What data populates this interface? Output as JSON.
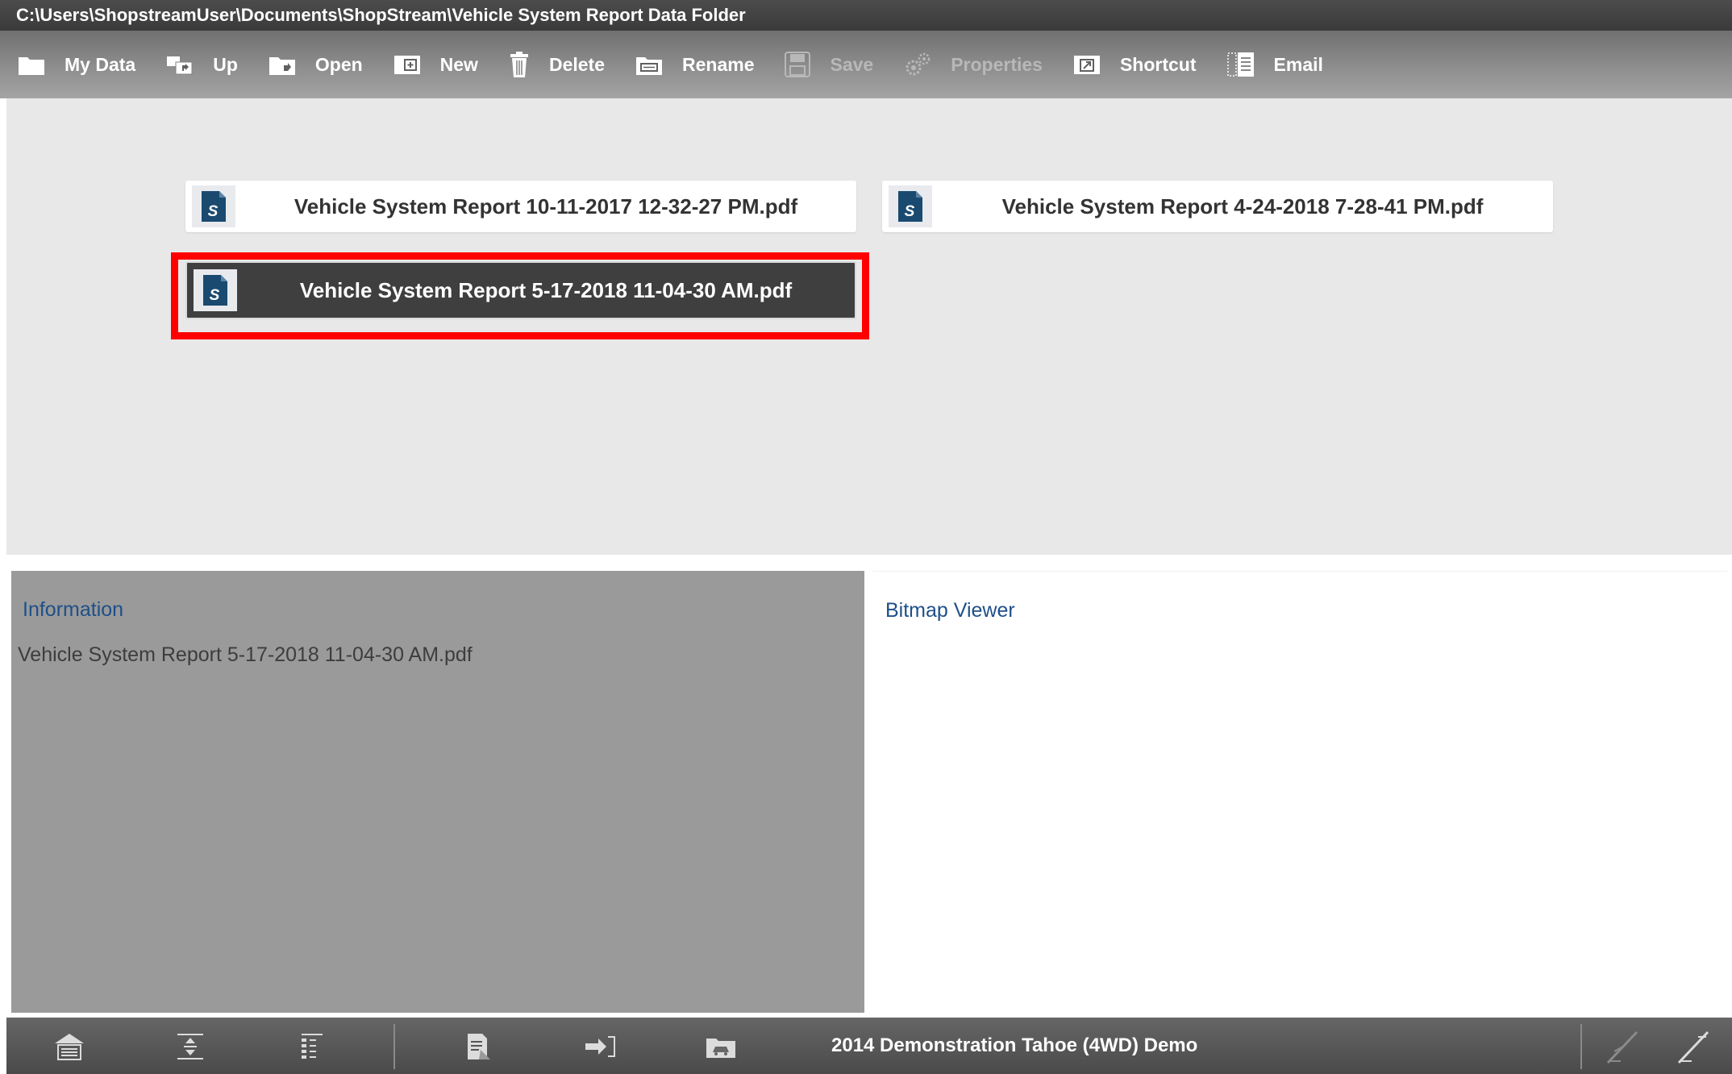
{
  "window": {
    "path": "C:\\Users\\ShopstreamUser\\Documents\\ShopStream\\Vehicle System Report Data Folder"
  },
  "toolbar": {
    "buttons": [
      {
        "label": "My Data",
        "icon": "folder-icon",
        "enabled": true
      },
      {
        "label": "Up",
        "icon": "up-folder-icon",
        "enabled": true
      },
      {
        "label": "Open",
        "icon": "open-folder-icon",
        "enabled": true
      },
      {
        "label": "New",
        "icon": "new-icon",
        "enabled": true
      },
      {
        "label": "Delete",
        "icon": "trash-icon",
        "enabled": true
      },
      {
        "label": "Rename",
        "icon": "rename-icon",
        "enabled": true
      },
      {
        "label": "Save",
        "icon": "save-icon",
        "enabled": false
      },
      {
        "label": "Properties",
        "icon": "gears-icon",
        "enabled": false
      },
      {
        "label": "Shortcut",
        "icon": "shortcut-icon",
        "enabled": true
      },
      {
        "label": "Email",
        "icon": "email-icon",
        "enabled": true
      }
    ]
  },
  "files": [
    {
      "name": "Vehicle System Report 10-11-2017 12-32-27 PM.pdf",
      "selected": false,
      "icon": "snapon-file-icon"
    },
    {
      "name": "Vehicle System Report 4-24-2018 7-28-41 PM.pdf",
      "selected": false,
      "icon": "snapon-file-icon"
    },
    {
      "name": "Vehicle System Report 5-17-2018 11-04-30 AM.pdf",
      "selected": true,
      "icon": "snapon-file-icon"
    }
  ],
  "info_panel": {
    "title": "Information",
    "filename": "Vehicle System Report 5-17-2018 11-04-30 AM.pdf"
  },
  "bitmap_panel": {
    "title": "Bitmap Viewer"
  },
  "bottom_bar": {
    "vehicle": "2014 Demonstration Tahoe (4WD) Demo",
    "icons": [
      "home-icon",
      "expand-icon",
      "list-icon",
      "report-icon",
      "exit-icon",
      "vehicle-icon",
      "tool-disabled-icon",
      "tool-icon"
    ]
  },
  "colors": {
    "selection_outline": "#ff0000",
    "panel_title": "#1e4f8a",
    "file_icon": "#1a4a70"
  }
}
